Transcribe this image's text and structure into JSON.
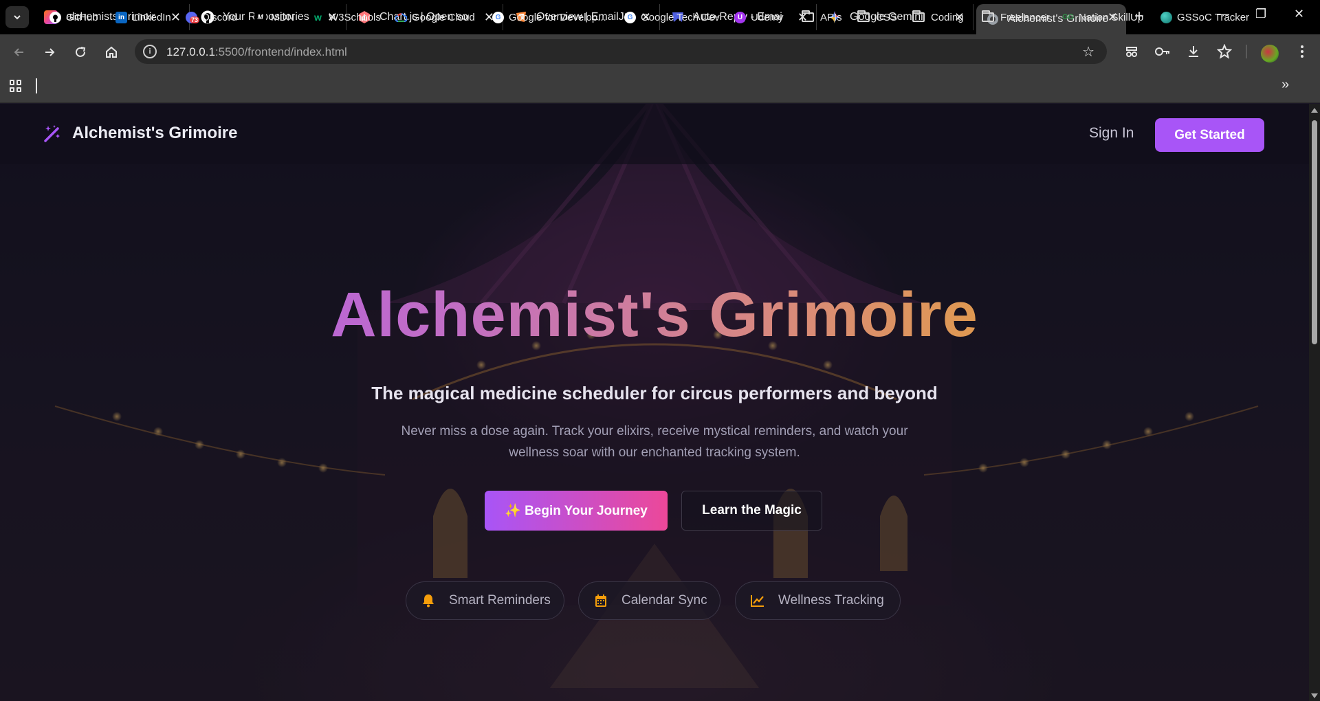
{
  "browser": {
    "tabs": [
      {
        "title": "alchemists-grimoire -",
        "icon": "lovable-icon",
        "color": "#f43f5e"
      },
      {
        "title": "Your Repositories",
        "icon": "github-icon",
        "color": "#000000"
      },
      {
        "title": "Chart.js | Open source",
        "icon": "chartjs-icon",
        "color": "#ff6384"
      },
      {
        "title": "Overview | EmailJS",
        "icon": "emailjs-icon",
        "color": "#ff8a3d"
      },
      {
        "title": "Auto-Reply - EmailJS",
        "icon": "emailjs-blue-icon",
        "color": "#3d4ed8"
      },
      {
        "title": "Google Gemini",
        "icon": "gemini-icon",
        "color": "#4f8df5"
      },
      {
        "title": "Alchemist's Grimoire",
        "icon": "globe-icon",
        "color": "#9aa0a6"
      }
    ],
    "url_host": "127.0.0.1",
    "url_path": ":5500/frontend/index.html",
    "bookmarks": [
      {
        "label": "GitHub",
        "icon": "github-icon"
      },
      {
        "label": "LinkedIn",
        "icon": "linkedin-icon"
      },
      {
        "label": "Discord",
        "icon": "discord-icon",
        "badge": "73"
      },
      {
        "label": "MDN",
        "icon": "mdn-icon"
      },
      {
        "label": "W3Schools",
        "icon": "w3schools-icon"
      },
      {
        "label": "Google Cloud",
        "icon": "google-cloud-icon"
      },
      {
        "label": "Google for Develop...",
        "icon": "google-icon"
      },
      {
        "label": "Google Tech Dev",
        "icon": "google-icon"
      },
      {
        "label": "Udemy",
        "icon": "udemy-icon"
      },
      {
        "label": "APIs",
        "icon": "folder-icon"
      },
      {
        "label": "CSS",
        "icon": "folder-icon"
      },
      {
        "label": "Coding",
        "icon": "folder-icon"
      },
      {
        "label": "Freelancer",
        "icon": "folder-icon"
      },
      {
        "label": "Nation SkillUp",
        "icon": "geeksforgeeks-icon"
      },
      {
        "label": "GSSoC Tracker",
        "icon": "gssoc-icon"
      }
    ]
  },
  "site": {
    "brand": "Alchemist's Grimoire",
    "nav": {
      "sign_in": "Sign In",
      "get_started": "Get Started"
    },
    "hero": {
      "title": "Alchemist's Grimoire",
      "subtitle": "The magical medicine scheduler for circus performers and beyond",
      "description": "Never miss a dose again. Track your elixirs, receive mystical reminders, and watch your wellness soar with our enchanted tracking system.",
      "primary_cta": "✨ Begin Your Journey",
      "secondary_cta": "Learn the Magic"
    },
    "features": [
      {
        "label": "Smart Reminders",
        "icon": "bell-icon"
      },
      {
        "label": "Calendar Sync",
        "icon": "calendar-icon"
      },
      {
        "label": "Wellness Tracking",
        "icon": "chart-line-icon"
      }
    ],
    "colors": {
      "accent": "#a855f7",
      "pink": "#ec4899",
      "gold": "#eab308",
      "icon_gold": "#f59e0b"
    }
  }
}
